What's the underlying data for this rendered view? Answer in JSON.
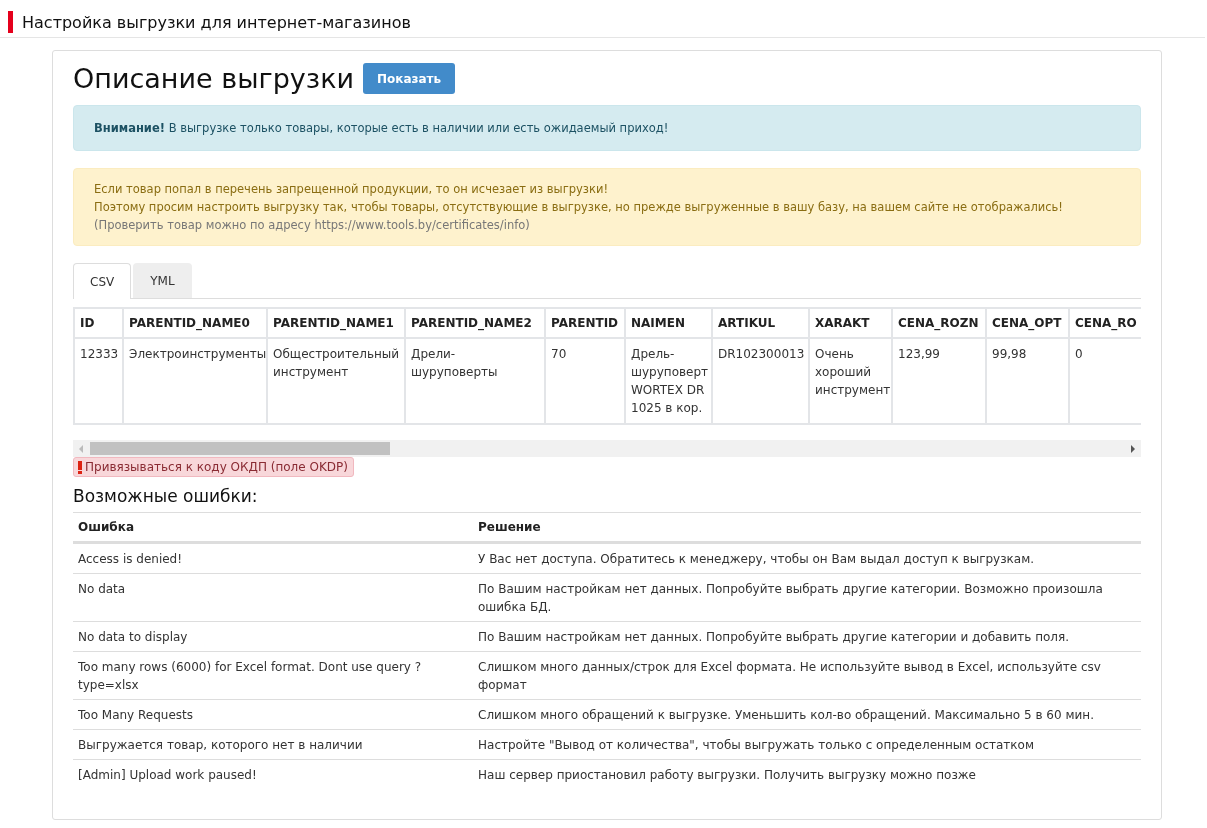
{
  "page_title": "Настройка выгрузки для интернет-магазинов",
  "section_title": "Описание выгрузки",
  "show_button": "Показать",
  "alerts": [
    {
      "kind": "info",
      "lines": [
        {
          "text": "**Внимание!** В выгрузке только товары, которые есть в наличии или есть ожидаемый приход!",
          "muted": false
        }
      ]
    },
    {
      "kind": "warning",
      "lines": [
        {
          "text": "Если товар попал в перечень запрещенной продукции, то он исчезает из выгрузки!",
          "muted": false
        },
        {
          "text": "Поэтому просим настроить выгрузку так, чтобы товары, отсутствующие в выгрузке, но прежде выгруженные в вашу базу, на вашем сайте не отображались!",
          "muted": false
        },
        {
          "text": "(Проверить товар можно по адресу https://www.tools.by/certificates/info)",
          "muted": true
        }
      ]
    }
  ],
  "tabs": [
    {
      "label": "CSV",
      "selected": true
    },
    {
      "label": "YML",
      "selected": false
    }
  ],
  "data_table": {
    "columns": [
      "ID",
      "PARENTID_NAME0",
      "PARENTID_NAME1",
      "PARENTID_NAME2",
      "PARENTID",
      "NAIMEN",
      "ARTIKUL",
      "XARAKT",
      "CENA_ROZN",
      "CENA_OPT",
      "CENA_RO"
    ],
    "rows": [
      [
        "12333",
        "Электроинструменты",
        "Общестроительный инструмент",
        "Дрели-шуруповерты",
        "70",
        "Дрель-шуруповерт WORTEX DR 1025 в кор.",
        "DR102300013",
        "Очень хороший инструмент",
        "123,99",
        "99,98",
        "0"
      ]
    ]
  },
  "okdp_note": "Привязываться к коду ОКДП (поле OKDP)",
  "errors_title": "Возможные ошибки:",
  "errors_table": {
    "columns": [
      "Ошибка",
      "Решение"
    ],
    "rows": [
      [
        "Access is denied!",
        "У Вас нет доступа. Обратитесь к менеджеру, чтобы он Вам выдал доступ к выгрузкам."
      ],
      [
        "No data",
        "По Вашим настройкам нет данных. Попробуйте выбрать другие категории. Возможно произошла ошибка БД."
      ],
      [
        "No data to display",
        "По Вашим настройкам нет данных. Попробуйте выбрать другие категории и добавить поля."
      ],
      [
        "Too many rows (6000) for Excel format. Dont use query ?type=xlsx",
        "Слишком много данных/строк для Excel формата. Не используйте вывод в Excel, используйте csv формат"
      ],
      [
        "Too Many Requests",
        "Слишком много обращений к выгрузке. Уменьшить кол-во обращений. Максимально 5 в 60 мин."
      ],
      [
        "Выгружается товар, которого нет в наличии",
        "Настройте \"Вывод от количества\", чтобы выгружать только с определенным остатком"
      ],
      [
        "[Admin] Upload work paused!",
        "Наш сервер приостановил работу выгрузки. Получить выгрузку можно позже"
      ]
    ]
  }
}
